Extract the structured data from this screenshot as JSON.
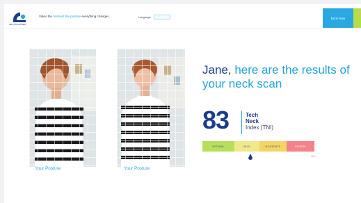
{
  "header": {
    "logo_text": "NECKSCANNER",
    "tagline_pre": "Video the ",
    "tagline_highlight": "moment the posture",
    "tagline_post": " everything changes",
    "language_label": "Language",
    "cta_label": "Book Now"
  },
  "photos": {
    "left_caption": "Your Posture",
    "right_caption": "Your Posture"
  },
  "results": {
    "title_name": "Jane, ",
    "title_rest": "here are the results of your neck scan",
    "score": "83",
    "tni_line1": "Tech",
    "tni_line2": "Neck",
    "tni_line3": "Index (TNI)",
    "scale_labels": [
      "OPTIMAL",
      "MILD",
      "MODERATE",
      "SEVERE"
    ],
    "scale_end": "100"
  },
  "colors": {
    "brand_navy": "#1d3d8a",
    "brand_blue": "#29a8e2",
    "accent_green": "#b8dd49"
  }
}
